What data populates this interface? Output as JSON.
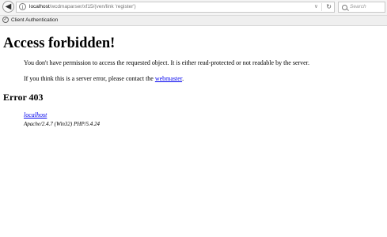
{
  "browser": {
    "url_host": "localhost",
    "url_path": "/wcdmaparser/xf15/(ven/link 'register')",
    "search_placeholder": "Search",
    "back_icon": "back-arrow-icon",
    "info_icon": "info-icon",
    "reload_icon": "reload-icon"
  },
  "tab": {
    "title": "Client Authentication"
  },
  "page": {
    "heading": "Access forbidden!",
    "message": "You don't have permission to access the requested object. It is either read-protected or not readable by the server.",
    "contact_prefix": "If you think this is a server error, please contact the ",
    "contact_link": "webmaster",
    "contact_suffix": ".",
    "error_heading": "Error 403",
    "server_host": "localhost",
    "server_signature": "Apache/2.4.7 (Win32) PHP/5.4.24"
  },
  "colors": {
    "link": "#0000ee"
  }
}
